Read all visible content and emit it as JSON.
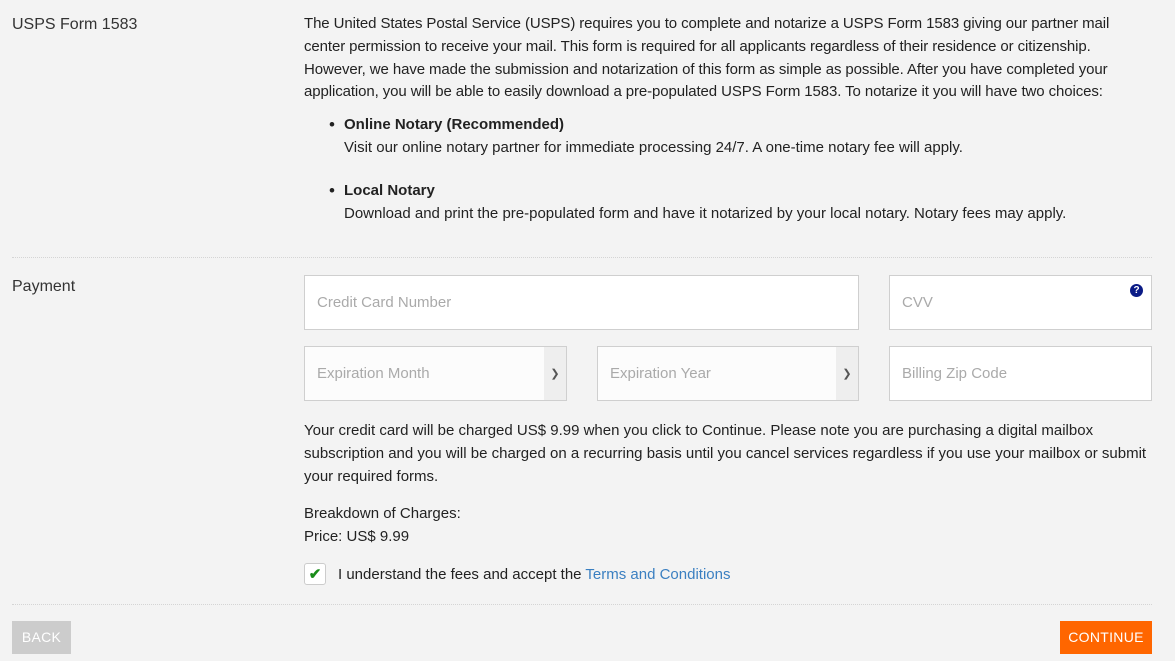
{
  "usps_section": {
    "label": "USPS Form 1583",
    "intro": "The United States Postal Service (USPS) requires you to complete and notarize a USPS Form 1583 giving our partner mail center permission to receive your mail. This form is required for all applicants regardless of their residence or citizenship. However, we have made the submission and notarization of this form as simple as possible. After you have completed your application, you will be able to easily download a pre-populated USPS Form 1583. To notarize it you will have two choices:",
    "choices": [
      {
        "title": "Online Notary (Recommended)",
        "description": "Visit our online notary partner for immediate processing 24/7. A one-time notary fee will apply."
      },
      {
        "title": "Local Notary",
        "description": "Download and print the pre-populated form and have it notarized by your local notary. Notary fees may apply."
      }
    ]
  },
  "payment_section": {
    "label": "Payment",
    "fields": {
      "card_number": {
        "placeholder": "Credit Card Number",
        "value": ""
      },
      "cvv": {
        "placeholder": "CVV",
        "value": "",
        "help_icon": "question-circle-icon"
      },
      "exp_month": {
        "placeholder": "Expiration Month",
        "selected": ""
      },
      "exp_year": {
        "placeholder": "Expiration Year",
        "selected": ""
      },
      "zip": {
        "placeholder": "Billing Zip Code",
        "value": ""
      }
    },
    "charge_notice": "Your credit card will be charged US$ 9.99 when you click to Continue. Please note you are purchasing a digital mailbox subscription and you will be charged on a recurring basis until you cancel services regardless if you use your mailbox or submit your required forms.",
    "breakdown_title": "Breakdown of Charges:",
    "price_line": "Price: US$ 9.99",
    "agree": {
      "checked": true,
      "text": "I understand the fees and accept the ",
      "link_text": "Terms and Conditions"
    }
  },
  "footer": {
    "back_label": "BACK",
    "continue_label": "CONTINUE"
  },
  "colors": {
    "accent": "#ff6600",
    "link": "#3a7fc1",
    "check": "#1a8c1a",
    "help_icon": "#0b1b86",
    "disabled_button": "#cccccc"
  }
}
